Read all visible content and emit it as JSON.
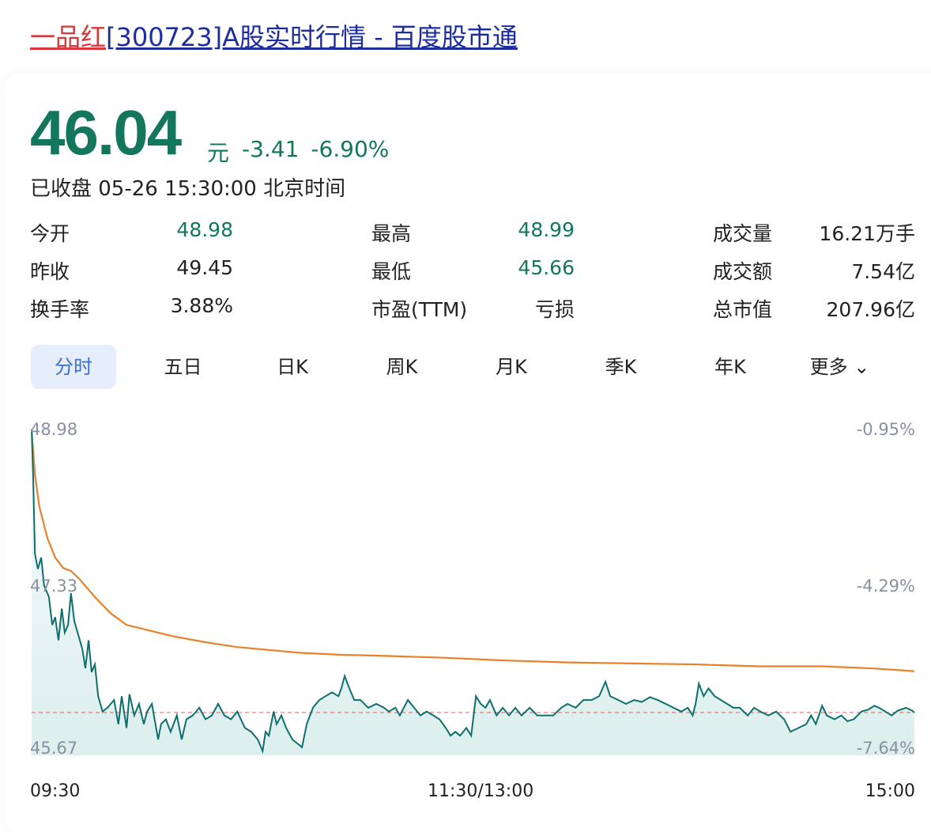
{
  "title": {
    "name": "一品红",
    "rest": "[300723]A股实时行情 - 百度股市通"
  },
  "quote": {
    "price": "46.04",
    "unit": "元",
    "change": "-3.41",
    "change_pct": "-6.90%",
    "status": "已收盘 05-26 15:30:00 北京时间"
  },
  "stats": [
    {
      "label": "今开",
      "value": "48.98"
    },
    {
      "label": "最高",
      "value": "48.99"
    },
    {
      "label": "成交量",
      "value": "16.21万手"
    },
    {
      "label": "昨收",
      "value": "49.45"
    },
    {
      "label": "最低",
      "value": "45.66"
    },
    {
      "label": "成交额",
      "value": "7.54亿"
    },
    {
      "label": "换手率",
      "value": "3.88%"
    },
    {
      "label": "市盈(TTM)",
      "value": "亏损"
    },
    {
      "label": "总市值",
      "value": "207.96亿"
    }
  ],
  "tabs": [
    "分时",
    "五日",
    "日K",
    "周K",
    "月K",
    "季K",
    "年K",
    "更多"
  ],
  "colors": {
    "down": "#13775c",
    "avg": "#e8812a",
    "line": "#0f6e6e",
    "title_red": "#d8373b",
    "title_blue": "#1d2d9e"
  },
  "chart_data": {
    "type": "line",
    "title": "分时",
    "x_unit": "minutes since 09:30 (trading time)",
    "xlim": [
      0,
      240
    ],
    "ylim": [
      45.67,
      48.98
    ],
    "y_ticks_left": [
      "48.98",
      "47.33",
      "45.67"
    ],
    "y_ticks_right": [
      "-0.95%",
      "-4.29%",
      "-7.64%"
    ],
    "x_ticks": [
      "09:30",
      "11:30/13:00",
      "15:00"
    ],
    "reference_line": 46.04,
    "series": [
      {
        "name": "price",
        "points": [
          [
            0,
            48.98
          ],
          [
            0.4,
            48.51
          ],
          [
            0.9,
            47.69
          ],
          [
            1.7,
            47.53
          ],
          [
            2.6,
            47.65
          ],
          [
            3.4,
            47.36
          ],
          [
            4.7,
            47.24
          ],
          [
            5.6,
            46.95
          ],
          [
            6.4,
            47.03
          ],
          [
            7.3,
            46.79
          ],
          [
            8.2,
            47.12
          ],
          [
            9.0,
            46.87
          ],
          [
            9.9,
            46.95
          ],
          [
            10.7,
            47.28
          ],
          [
            11.6,
            46.99
          ],
          [
            12.5,
            46.87
          ],
          [
            13.8,
            46.7
          ],
          [
            14.6,
            46.5
          ],
          [
            15.5,
            46.79
          ],
          [
            16.3,
            46.46
          ],
          [
            17.2,
            46.54
          ],
          [
            18.1,
            46.21
          ],
          [
            19.3,
            46.05
          ],
          [
            20.6,
            46.09
          ],
          [
            22.4,
            46.17
          ],
          [
            23.6,
            45.92
          ],
          [
            24.5,
            46.21
          ],
          [
            25.8,
            45.88
          ],
          [
            26.6,
            46.23
          ],
          [
            27.9,
            46.01
          ],
          [
            29.2,
            46.13
          ],
          [
            30.5,
            45.92
          ],
          [
            31.4,
            46.05
          ],
          [
            32.7,
            46.13
          ],
          [
            34.4,
            45.76
          ],
          [
            35.2,
            45.92
          ],
          [
            36.5,
            45.97
          ],
          [
            37.8,
            45.84
          ],
          [
            39.5,
            46.01
          ],
          [
            40.8,
            45.76
          ],
          [
            42.1,
            45.97
          ],
          [
            43.8,
            46.01
          ],
          [
            45.6,
            46.09
          ],
          [
            47.3,
            45.97
          ],
          [
            49.0,
            46.01
          ],
          [
            50.7,
            46.13
          ],
          [
            52.4,
            46.01
          ],
          [
            54.2,
            45.97
          ],
          [
            55.9,
            46.05
          ],
          [
            58.0,
            45.88
          ],
          [
            59.7,
            45.84
          ],
          [
            61.5,
            45.76
          ],
          [
            62.8,
            45.64
          ],
          [
            63.6,
            45.84
          ],
          [
            64.5,
            45.8
          ],
          [
            65.8,
            46.05
          ],
          [
            66.6,
            45.92
          ],
          [
            67.9,
            46.01
          ],
          [
            69.2,
            45.88
          ],
          [
            70.9,
            45.76
          ],
          [
            72.2,
            45.72
          ],
          [
            73.5,
            45.68
          ],
          [
            74.8,
            45.92
          ],
          [
            76.5,
            46.09
          ],
          [
            78.2,
            46.17
          ],
          [
            79.9,
            46.21
          ],
          [
            81.7,
            46.25
          ],
          [
            83.4,
            46.21
          ],
          [
            84.2,
            46.29
          ],
          [
            85.1,
            46.42
          ],
          [
            86.4,
            46.29
          ],
          [
            87.7,
            46.17
          ],
          [
            89.4,
            46.17
          ],
          [
            91.5,
            46.09
          ],
          [
            93.7,
            46.13
          ],
          [
            95.8,
            46.09
          ],
          [
            97.1,
            46.05
          ],
          [
            98.9,
            46.09
          ],
          [
            100.1,
            46.01
          ],
          [
            102.3,
            46.17
          ],
          [
            104.0,
            46.09
          ],
          [
            105.7,
            46.01
          ],
          [
            107.4,
            46.05
          ],
          [
            109.2,
            46.01
          ],
          [
            110.9,
            45.97
          ],
          [
            112.6,
            45.88
          ],
          [
            113.9,
            45.8
          ],
          [
            115.2,
            45.84
          ],
          [
            116.5,
            45.8
          ],
          [
            118.2,
            45.88
          ],
          [
            119.5,
            45.8
          ],
          [
            120.8,
            46.21
          ],
          [
            122.1,
            46.13
          ],
          [
            123.4,
            46.09
          ],
          [
            124.6,
            46.17
          ],
          [
            126.4,
            46.01
          ],
          [
            128.1,
            46.09
          ],
          [
            129.8,
            46.01
          ],
          [
            131.5,
            46.09
          ],
          [
            133.2,
            46.01
          ],
          [
            135.4,
            46.09
          ],
          [
            137.5,
            46.01
          ],
          [
            139.7,
            46.01
          ],
          [
            141.8,
            46.01
          ],
          [
            144.0,
            46.09
          ],
          [
            145.7,
            46.13
          ],
          [
            147.9,
            46.09
          ],
          [
            150.0,
            46.17
          ],
          [
            152.2,
            46.17
          ],
          [
            154.3,
            46.21
          ],
          [
            156.0,
            46.36
          ],
          [
            157.3,
            46.21
          ],
          [
            159.5,
            46.17
          ],
          [
            161.6,
            46.13
          ],
          [
            163.8,
            46.17
          ],
          [
            165.9,
            46.15
          ],
          [
            168.1,
            46.2
          ],
          [
            170.2,
            46.17
          ],
          [
            172.4,
            46.13
          ],
          [
            174.5,
            46.09
          ],
          [
            176.6,
            46.05
          ],
          [
            178.4,
            46.09
          ],
          [
            179.7,
            46.01
          ],
          [
            180.5,
            46.13
          ],
          [
            181.4,
            46.34
          ],
          [
            182.7,
            46.21
          ],
          [
            184.0,
            46.29
          ],
          [
            185.7,
            46.21
          ],
          [
            187.4,
            46.17
          ],
          [
            189.1,
            46.13
          ],
          [
            190.8,
            46.09
          ],
          [
            192.5,
            46.09
          ],
          [
            194.7,
            46.01
          ],
          [
            196.4,
            46.09
          ],
          [
            198.1,
            46.05
          ],
          [
            200.3,
            46.01
          ],
          [
            202.4,
            46.05
          ],
          [
            204.6,
            45.97
          ],
          [
            206.3,
            45.84
          ],
          [
            208.5,
            45.88
          ],
          [
            210.6,
            45.92
          ],
          [
            211.9,
            46.01
          ],
          [
            213.2,
            45.92
          ],
          [
            214.9,
            46.11
          ],
          [
            216.2,
            46.01
          ],
          [
            218.3,
            45.97
          ],
          [
            220.1,
            46.01
          ],
          [
            221.8,
            45.95
          ],
          [
            223.5,
            45.97
          ],
          [
            225.6,
            46.05
          ],
          [
            227.4,
            46.07
          ],
          [
            229.1,
            46.11
          ],
          [
            230.4,
            46.09
          ],
          [
            232.1,
            46.05
          ],
          [
            233.8,
            46.01
          ],
          [
            235.5,
            46.06
          ],
          [
            237.7,
            46.09
          ],
          [
            239.4,
            46.06
          ],
          [
            240,
            46.04
          ]
        ]
      },
      {
        "name": "average",
        "points": [
          [
            0,
            48.98
          ],
          [
            0.9,
            48.51
          ],
          [
            2.1,
            48.18
          ],
          [
            4.3,
            47.85
          ],
          [
            6.4,
            47.65
          ],
          [
            8.6,
            47.54
          ],
          [
            10.7,
            47.51
          ],
          [
            12.9,
            47.43
          ],
          [
            17.2,
            47.24
          ],
          [
            21.5,
            47.07
          ],
          [
            25.8,
            46.95
          ],
          [
            30.1,
            46.91
          ],
          [
            38.7,
            46.83
          ],
          [
            47.3,
            46.77
          ],
          [
            55.9,
            46.72
          ],
          [
            64.5,
            46.69
          ],
          [
            73.1,
            46.66
          ],
          [
            83.8,
            46.64
          ],
          [
            94.6,
            46.63
          ],
          [
            111.7,
            46.61
          ],
          [
            128.9,
            46.58
          ],
          [
            146.1,
            46.56
          ],
          [
            163.3,
            46.55
          ],
          [
            180.5,
            46.54
          ],
          [
            197.7,
            46.52
          ],
          [
            214.9,
            46.52
          ],
          [
            227.8,
            46.5
          ],
          [
            240,
            46.47
          ]
        ]
      }
    ]
  }
}
